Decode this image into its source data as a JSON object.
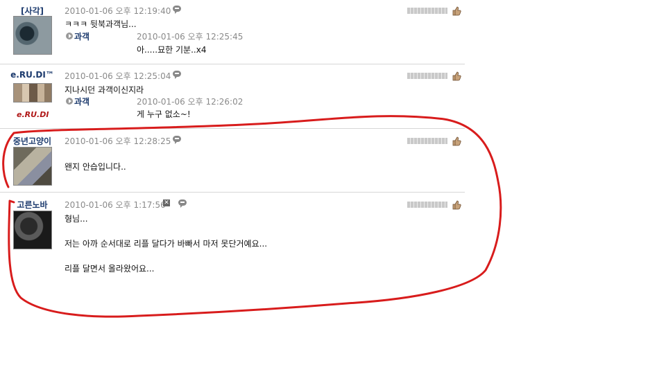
{
  "comments": [
    {
      "nick": "[사각]",
      "date": "2010-01-06 오후 12:19:40",
      "lines": [
        "ㅋㅋㅋ 뒷북과객님..."
      ],
      "reply": {
        "nick": "과객",
        "date": "2010-01-06 오후 12:25:45",
        "text": "아.....묘한 기분..x4"
      }
    },
    {
      "nick": "e.RU.DI™",
      "date": "2010-01-06 오후 12:25:04",
      "lines": [
        "지나시던 과객이신지라"
      ],
      "reply": {
        "nick": "과객",
        "date": "2010-01-06 오후 12:26:02",
        "text": "게 누구 없소~!"
      },
      "logo_text": "e.RU.DI"
    },
    {
      "nick": "중년고양이",
      "date": "2010-01-06 오후 12:28:25",
      "lines": [
        "왠지 안습입니다.."
      ]
    },
    {
      "nick": "고른노바",
      "date": "2010-01-06 오후 1:17:56",
      "lines": [
        "형님...",
        "저는 아까 순서대로 리플 달다가 바빠서 마저 못단거예요...",
        "리플 달면서 올라왔어요..."
      ]
    }
  ],
  "icons": {
    "comment": "speech-bubble-icon",
    "delete": "delete-x-icon",
    "rating": "rating-bar",
    "recommend": "thumbs-up-icon",
    "reply": "reply-arrow-icon"
  },
  "colors": {
    "nick": "#1d3b6e",
    "date": "#8a8a8a",
    "annotation": "#d81c1c",
    "logo": "#b01818"
  }
}
